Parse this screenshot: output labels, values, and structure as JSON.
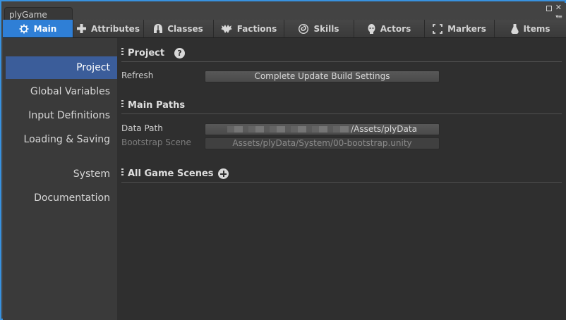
{
  "window": {
    "tab_title": "plyGame",
    "controls": [
      "maximize-icon",
      "close-icon",
      "menu-icon"
    ]
  },
  "nav": {
    "tabs": [
      {
        "label": "Main",
        "icon": "gear-icon",
        "active": true
      },
      {
        "label": "Attributes",
        "icon": "plus-icon"
      },
      {
        "label": "Classes",
        "icon": "helmet-icon"
      },
      {
        "label": "Factions",
        "icon": "wings-icon"
      },
      {
        "label": "Skills",
        "icon": "swirl-icon"
      },
      {
        "label": "Actors",
        "icon": "head-icon"
      },
      {
        "label": "Markers",
        "icon": "markers-icon"
      },
      {
        "label": "Items",
        "icon": "potion-icon"
      }
    ]
  },
  "sidebar": {
    "items": [
      {
        "label": "Project",
        "active": true
      },
      {
        "label": "Global Variables"
      },
      {
        "label": "Input Definitions"
      },
      {
        "label": "Loading & Saving"
      },
      {
        "label": "System"
      },
      {
        "label": "Documentation"
      }
    ]
  },
  "project": {
    "title": "Project",
    "help": "?",
    "refresh_label": "Refresh",
    "refresh_button": "Complete Update Build Settings"
  },
  "main_paths": {
    "title": "Main Paths",
    "data_path_label": "Data Path",
    "data_path_value": "/Assets/plyData",
    "bootstrap_label": "Bootstrap Scene",
    "bootstrap_value": "Assets/plyData/System/00-bootstrap.unity"
  },
  "scenes": {
    "title": "All Game Scenes"
  },
  "colors": {
    "accent": "#2f7fd6",
    "sidebar_active": "#3b5d9a",
    "frame": "#3892e0"
  }
}
